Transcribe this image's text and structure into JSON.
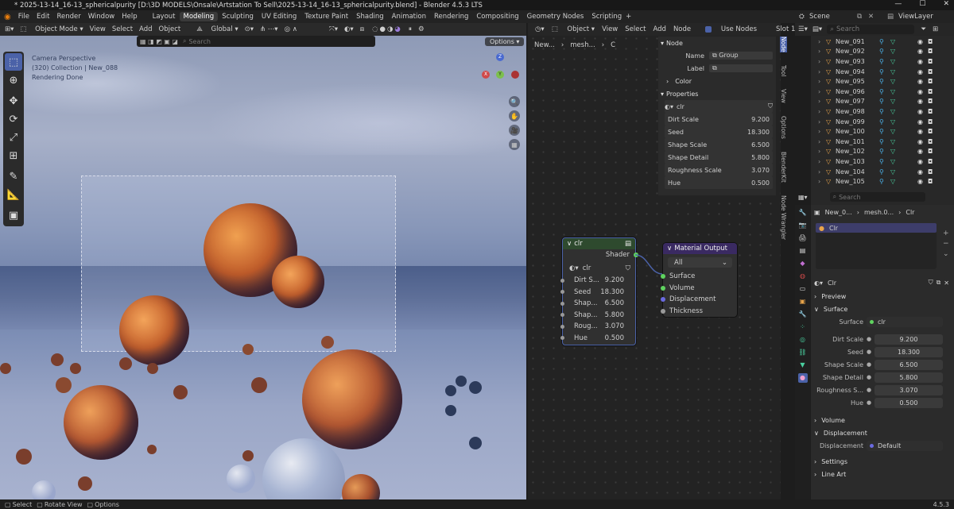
{
  "window": {
    "title": "* 2025-13-14_16-13_sphericalpurity [D:\\3D MODELS\\Onsale\\Artstation To Sell\\2025-13-14_16-13_sphericalpurity.blend] - Blender 4.5.3 LTS",
    "version": "4.5.3"
  },
  "menu": {
    "items": [
      "File",
      "Edit",
      "Render",
      "Window",
      "Help"
    ],
    "workspaces": [
      "Layout",
      "Modeling",
      "Sculpting",
      "UV Editing",
      "Texture Paint",
      "Shading",
      "Animation",
      "Rendering",
      "Compositing",
      "Geometry Nodes",
      "Scripting"
    ],
    "active_workspace": "Modeling",
    "add_tab": "+",
    "scene": "Scene",
    "view_layer": "ViewLayer"
  },
  "viewport": {
    "mode": "Object Mode",
    "menus": [
      "View",
      "Select",
      "Add",
      "Object"
    ],
    "transform": "Global",
    "search_placeholder": "Search",
    "options": "Options",
    "overlay_lines": [
      "Camera Perspective",
      "(320) Collection | New_088",
      "Rendering Done"
    ],
    "gizmo_axes": [
      "X",
      "Y",
      "Z"
    ]
  },
  "node_editor": {
    "header": {
      "type": "Object",
      "menus": [
        "View",
        "Select",
        "Add",
        "Node"
      ],
      "use_nodes": "Use Nodes",
      "slot": "Slot 1"
    },
    "breadcrumb": [
      "New...",
      "mesh...",
      "C"
    ],
    "panel": {
      "node_section": "Node",
      "name_label": "Name",
      "name_value": "Group",
      "label_label": "Label",
      "color_label": "Color",
      "properties_section": "Properties",
      "group": "clr",
      "fields": [
        {
          "k": "Dirt Scale",
          "v": "9.200"
        },
        {
          "k": "Seed",
          "v": "18.300"
        },
        {
          "k": "Shape Scale",
          "v": "6.500"
        },
        {
          "k": "Shape Detail",
          "v": "5.800"
        },
        {
          "k": "Roughness Scale",
          "v": "3.070"
        },
        {
          "k": "Hue",
          "v": "0.500"
        }
      ]
    },
    "side_tabs": [
      "Node",
      "Tool",
      "View",
      "Options",
      "BlenderKit",
      "Node Wrangler"
    ],
    "group_node": {
      "title": "clr",
      "output": "Shader",
      "datablock": "clr",
      "inputs": [
        {
          "k": "Dirt S...",
          "v": "9.200"
        },
        {
          "k": "Seed",
          "v": "18.300"
        },
        {
          "k": "Shap...",
          "v": "6.500"
        },
        {
          "k": "Shap...",
          "v": "5.800"
        },
        {
          "k": "Roug...",
          "v": "3.070"
        },
        {
          "k": "Hue",
          "v": "0.500"
        }
      ]
    },
    "output_node": {
      "title": "Material Output",
      "target": "All",
      "inputs": [
        "Surface",
        "Volume",
        "Displacement",
        "Thickness"
      ]
    }
  },
  "outliner": {
    "search_placeholder": "Search",
    "items": [
      "New_091",
      "New_092",
      "New_093",
      "New_094",
      "New_095",
      "New_096",
      "New_097",
      "New_098",
      "New_099",
      "New_100",
      "New_101",
      "New_102",
      "New_103",
      "New_104",
      "New_105"
    ]
  },
  "properties": {
    "search_placeholder": "Search",
    "breadcrumb": [
      "New_0...",
      "mesh.0...",
      "Clr"
    ],
    "slot": "Clr",
    "material": "Clr",
    "sections": {
      "preview": "Preview",
      "surface": "Surface",
      "volume": "Volume",
      "displacement": "Displacement",
      "settings": "Settings",
      "line_art": "Line Art"
    },
    "surface_label": "Surface",
    "surface_value": "clr",
    "fields": [
      {
        "k": "Dirt Scale",
        "v": "9.200"
      },
      {
        "k": "Seed",
        "v": "18.300"
      },
      {
        "k": "Shape Scale",
        "v": "6.500"
      },
      {
        "k": "Shape Detail",
        "v": "5.800"
      },
      {
        "k": "Roughness S...",
        "v": "3.070"
      },
      {
        "k": "Hue",
        "v": "0.500"
      }
    ],
    "displacement_label": "Displacement",
    "displacement_value": "Default"
  },
  "status": {
    "select": "Select",
    "rotate": "Rotate View",
    "options": "Options"
  },
  "colors": {
    "accent": "#4b62a8",
    "shader_socket": "#5fd35f",
    "output_header": "#3a2a62",
    "group_header": "#2e4a2e"
  }
}
